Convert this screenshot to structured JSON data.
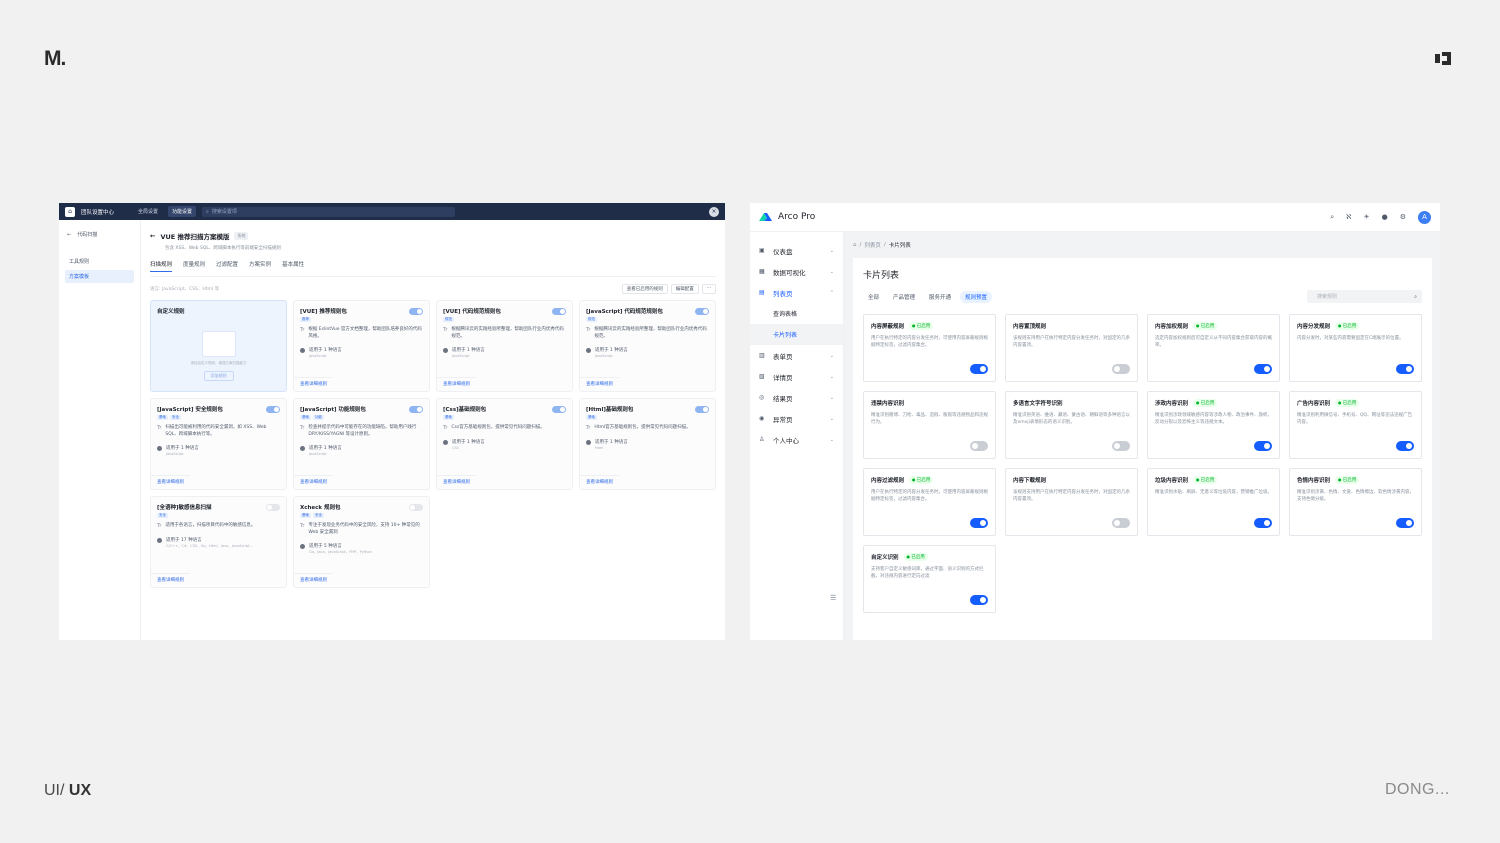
{
  "brand": {
    "logo_text": "M.",
    "footer_left_light": "UI/ ",
    "footer_left_bold": "UX",
    "footer_right": "DONG..."
  },
  "shotA": {
    "top": {
      "brand": "团队设置中心",
      "tabs": [
        "全局设置",
        "功能设置"
      ],
      "search_placeholder": "搜索设置项"
    },
    "side": {
      "back": "代码扫描",
      "items": [
        "工具规则",
        "方案模板"
      ]
    },
    "title": "VUE 推荐扫描方案模版",
    "title_badge": "系统",
    "subtitle": "包含 XSS、Web SQL、跨域脚本执行等前端安全扫描规则",
    "tabs": [
      "扫描规则",
      "度量规则",
      "过滤配置",
      "方案实例",
      "基本属性"
    ],
    "filter": "语言: JavaScript、CSS、Html 等",
    "buttons": [
      "查看已启用的规则",
      "编辑配置",
      "···"
    ],
    "custom": {
      "title": "自定义规则",
      "caption": "添加自定义规则，增强方案扫描能力",
      "button": "添加规则"
    },
    "link": "查看详细规则",
    "cards": [
      {
        "title": "[VUE] 推荐规则包",
        "tags": [
          "推荐"
        ],
        "desc": "根据 EslintVue 官方文档整理，帮助团队培养良好的代码风格。",
        "lang": "适用于 1 种语言",
        "langs": "JavaScript",
        "on": true
      },
      {
        "title": "[VUE] 代码规范规则包",
        "tags": [
          "规范"
        ],
        "desc": "根据腾讯云的实践经验所整理，帮助团队行业内优秀代码规范。",
        "lang": "适用于 1 种语言",
        "langs": "JavaScript",
        "on": true
      },
      {
        "title": "[JavaScript] 代码规范规则包",
        "tags": [
          "规范"
        ],
        "desc": "根据腾讯云的实践经验所整理，帮助团队行业内优秀代码规范。",
        "lang": "适用于 1 种语言",
        "langs": "JavaScript",
        "on": true
      },
      {
        "title": "[JavaScript] 安全规则包",
        "tags": [
          "基础",
          "安全"
        ],
        "desc": "扫描出可能被利用的代码安全漏洞，如 XSS、Web SQL、跨域脚本执行等。",
        "lang": "适用于 1 种语言",
        "langs": "JavaScript",
        "on": true
      },
      {
        "title": "[JavaScript] 功能规则包",
        "tags": [
          "基础",
          "功能"
        ],
        "desc": "检查并提示代码中可能存在的功能缺陷，帮助用户践行 DRY/KISS/YAGNI 等设计原则。",
        "lang": "适用于 1 种语言",
        "langs": "JavaScript",
        "on": true
      },
      {
        "title": "[Css]基础规则包",
        "tags": [
          "基础"
        ],
        "desc": "Css官方基础规则包，提供常见代码问题扫描。",
        "lang": "适用于 1 种语言",
        "langs": "CSS",
        "on": true
      },
      {
        "title": "[Html]基础规则包",
        "tags": [
          "基础"
        ],
        "desc": "Html官方基础规则包，提供常见代码问题扫描。",
        "lang": "适用于 1 种语言",
        "langs": "Html",
        "on": true
      },
      {
        "title": "[全语种]敏感信息扫描",
        "tags": [
          "安全"
        ],
        "desc": "适用于各语言，扫描项目代码中的敏感信息。",
        "lang": "适用于 17 种语言",
        "langs": "C/C++、C#、CSS、Go、Html、Java、JavaScript...",
        "on": false
      },
      {
        "title": "Xcheck 规则包",
        "tags": [
          "基础",
          "安全"
        ],
        "desc": "专注于发现业务代码中的安全风险，支持 10+ 种常见的 Web 安全漏洞",
        "lang": "适用于 5 种语言",
        "langs": "Go、Java、JavaScript、PHP、Python",
        "on": false
      }
    ]
  },
  "shotB": {
    "brand": "Arco Pro",
    "avatar": "A",
    "menu": [
      {
        "label": "仪表盘",
        "icon": "▣",
        "open": false
      },
      {
        "label": "数据可视化",
        "icon": "▦",
        "open": false
      },
      {
        "label": "列表页",
        "icon": "▤",
        "open": true,
        "children": [
          "查询表格",
          "卡片列表"
        ]
      },
      {
        "label": "表单页",
        "icon": "▥",
        "open": false
      },
      {
        "label": "详情页",
        "icon": "▧",
        "open": false
      },
      {
        "label": "结果页",
        "icon": "◎",
        "open": false
      },
      {
        "label": "异常页",
        "icon": "◉",
        "open": false
      },
      {
        "label": "个人中心",
        "icon": "♙",
        "open": false
      }
    ],
    "crumb": [
      "列表页",
      "卡片列表"
    ],
    "heading": "卡片列表",
    "tabs": [
      "全部",
      "产品管理",
      "服务开通",
      "规则预置"
    ],
    "search_placeholder": "搜索规则",
    "status": "已启用",
    "cards": [
      {
        "title": "内容屏蔽规则",
        "status": true,
        "desc": "用户在执行特定的内容分发任务时，可使用内容屏蔽规则根据特定标签，过滤内容集合。",
        "on": true
      },
      {
        "title": "内容置顶规则",
        "status": false,
        "desc": "该规则支持用户在执行特定内容分发任务时，对固定的几条内容置顶。",
        "on": false
      },
      {
        "title": "内容加权规则",
        "status": true,
        "desc": "选定内容加权规则后可自定义从不同内容集合获取内容的概率。",
        "on": true
      },
      {
        "title": "内容分发规则",
        "status": true,
        "desc": "内容分发时，对某些内容需要固定在C端展示的位置。",
        "on": true
      },
      {
        "title": "违禁内容识别",
        "status": false,
        "desc": "精准识别赌博、刀枪、毒品、造假、贩假等违规物品和违规行为。",
        "on": false
      },
      {
        "title": "多语言文字符号识别",
        "status": false,
        "desc": "精准识别英语、维语、藏语、蒙古语、朝鲜语等多种语言以及emoji表情形态的语义识别。",
        "on": false
      },
      {
        "title": "涉政内容识别",
        "status": true,
        "desc": "精准识别涉政领域敏感内容等涉政人物、政治事件、旗帜，反动分裂以及恐怖主义等违规文本。",
        "on": true
      },
      {
        "title": "广告内容识别",
        "status": true,
        "desc": "精准识别利用微信号、手机号、QQ、网址等违法违规广告内容。",
        "on": true
      },
      {
        "title": "内容过滤规则",
        "status": true,
        "desc": "用户在执行特定的内容分发任务时，可使用内容屏蔽规则根据特定标签，过滤内容集合。",
        "on": true
      },
      {
        "title": "内容下载规则",
        "status": false,
        "desc": "该规则支持用户在执行特定内容分发任务时，对固定的几条内容置顶。",
        "on": false
      },
      {
        "title": "垃圾内容识别",
        "status": true,
        "desc": "精准识别水贴、刷屏、无意义等垃圾内容，营销推广垃圾。",
        "on": true
      },
      {
        "title": "色情内容识别",
        "status": true,
        "desc": "精准识别涉黄、色情、文爱、色情擦边、软色情涉黄内容，支持色情分级。",
        "on": true
      },
      {
        "title": "自定义识别",
        "status": true,
        "desc": "支持客户自定义敏感词库，通过字面、语义识别的方式拦截，对违规内容进行定向过滤",
        "on": true
      }
    ]
  }
}
